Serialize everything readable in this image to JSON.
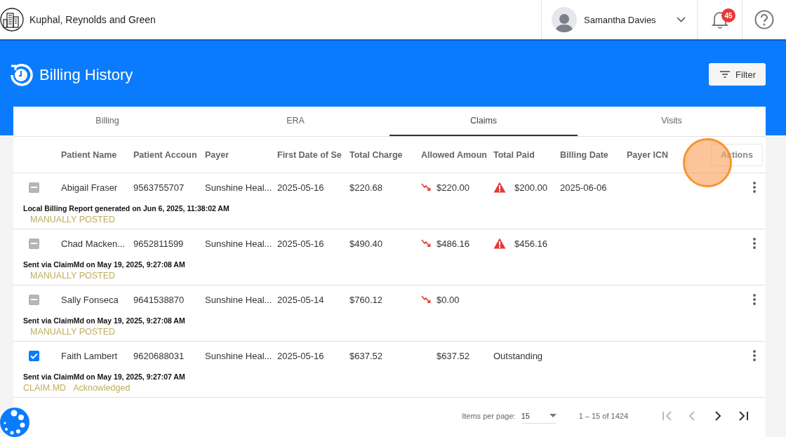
{
  "header": {
    "company": "Kuphal, Reynolds and Green",
    "user": {
      "name": "Samantha Davies"
    },
    "notifications": {
      "count": "45"
    }
  },
  "page": {
    "title": "Billing History",
    "filter_button": "Filter"
  },
  "tabs": [
    {
      "label": "Billing",
      "selected": false
    },
    {
      "label": "ERA",
      "selected": false
    },
    {
      "label": "Claims",
      "selected": true
    },
    {
      "label": "Visits",
      "selected": false
    }
  ],
  "table": {
    "columns": [
      "Patient Name",
      "Patient Accoun",
      "Payer",
      "First Date of Se",
      "Total Charge",
      "Allowed Amoun",
      "Total Paid",
      "Billing Date",
      "Payer ICN",
      "Actions"
    ],
    "rows": [
      {
        "checked": true,
        "indeterminate": true,
        "patient_name": "Abigail Fraser",
        "patient_account": "9563755707",
        "payer": "Sunshine Heal...",
        "first_date": "2025-05-16",
        "total_charge": "$220.68",
        "allowed_amount": "$220.00",
        "allowed_down": true,
        "total_paid": "$200.00",
        "paid_warning": true,
        "billing_date": "2025-06-06",
        "note": "Local Billing Report generated on Jun 6, 2025, 11:38:02 AM",
        "tags": [
          "MANUALLY POSTED"
        ]
      },
      {
        "checked": true,
        "indeterminate": true,
        "patient_name": "Chad Macken...",
        "patient_account": "9652811599",
        "payer": "Sunshine Heal...",
        "first_date": "2025-05-16",
        "total_charge": "$490.40",
        "allowed_amount": "$486.16",
        "allowed_down": true,
        "total_paid": "$456.16",
        "paid_warning": true,
        "note": "Sent via ClaimMd on May 19, 2025, 9:27:08 AM",
        "tags": [
          "MANUALLY POSTED"
        ]
      },
      {
        "checked": true,
        "indeterminate": true,
        "patient_name": "Sally Fonseca",
        "patient_account": "9641538870",
        "payer": "Sunshine Heal...",
        "first_date": "2025-05-14",
        "total_charge": "$760.12",
        "allowed_amount": "$0.00",
        "allowed_down": true,
        "paid_warning": false,
        "note": "Sent via ClaimMd on May 19, 2025, 9:27:08 AM",
        "tags": [
          "MANUALLY POSTED"
        ]
      },
      {
        "checked": true,
        "indeterminate": false,
        "patient_name": "Faith Lambert",
        "patient_account": "9620688031",
        "payer": "Sunshine Heal...",
        "first_date": "2025-05-16",
        "total_charge": "$637.52",
        "allowed_amount": "$637.52",
        "allowed_down": false,
        "total_paid": "Outstanding",
        "paid_warning": false,
        "note": "Sent via ClaimMd on May 19, 2025, 9:27:07 AM",
        "tags": [
          "CLAIM.MD",
          "Acknowledged"
        ]
      }
    ]
  },
  "pagination": {
    "items_per_page_label": "Items per page:",
    "items_per_page": "15",
    "range": "1 – 15 of 1424",
    "buttons": [
      {
        "kind": "first",
        "disabled": true
      },
      {
        "kind": "prev",
        "disabled": true
      },
      {
        "kind": "next",
        "disabled": false
      },
      {
        "kind": "last",
        "disabled": false
      }
    ]
  }
}
